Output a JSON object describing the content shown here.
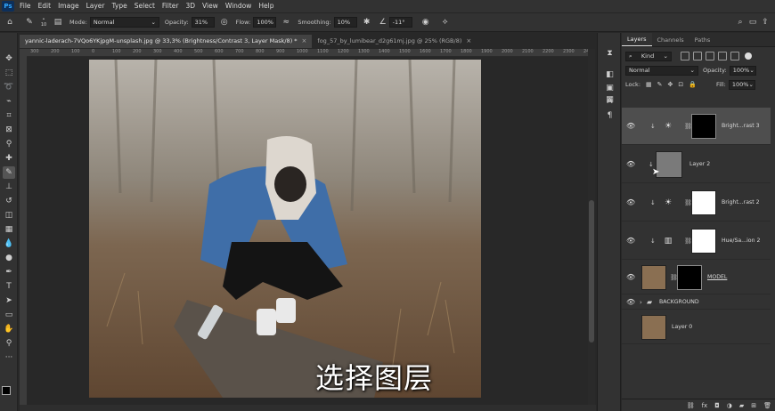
{
  "menu": [
    "File",
    "Edit",
    "Image",
    "Layer",
    "Type",
    "Select",
    "Filter",
    "3D",
    "View",
    "Window",
    "Help"
  ],
  "options": {
    "brush_size": "10",
    "mode_label": "Mode:",
    "mode_value": "Normal",
    "opacity_label": "Opacity:",
    "opacity_value": "31%",
    "flow_label": "Flow:",
    "flow_value": "100%",
    "smoothing_label": "Smoothing:",
    "smoothing_value": "10%",
    "angle_value": "-11°"
  },
  "tabs": [
    {
      "label": "yannic-laderach-7VQo6YKjpgM-unsplash.jpg @ 33,3% (Brightness/Contrast 3, Layer Mask/8) *",
      "active": true
    },
    {
      "label": "fog_57_by_lumibear_d2g61mj.jpg @ 25% (RGB/8)",
      "active": false
    }
  ],
  "ruler_labels": [
    "300",
    "200",
    "100",
    "0",
    "100",
    "200",
    "300",
    "400",
    "500",
    "600",
    "700",
    "800",
    "900",
    "1000",
    "1100",
    "1200",
    "1300",
    "1400",
    "1500",
    "1600",
    "1700",
    "1800",
    "1900",
    "2000",
    "2100",
    "2200",
    "2300",
    "2400"
  ],
  "subtitle": "选择图层",
  "layers_panel": {
    "tabs": [
      "Layers",
      "Channels",
      "Paths"
    ],
    "filter_label": "Kind",
    "blend_mode": "Normal",
    "opacity_label": "Opacity:",
    "opacity_value": "100%",
    "lock_label": "Lock:",
    "fill_label": "Fill:",
    "fill_value": "100%",
    "layers": [
      {
        "name": "Bright...rast 3",
        "selected": true
      },
      {
        "name": "Layer 2",
        "selected": false
      },
      {
        "name": "Bright...rast 2",
        "selected": false
      },
      {
        "name": "Hue/Sa...ion 2",
        "selected": false
      },
      {
        "name": "MODEL",
        "selected": false
      },
      {
        "name": "BACKGROUND",
        "selected": false
      },
      {
        "name": "Layer 0",
        "selected": false
      }
    ]
  }
}
